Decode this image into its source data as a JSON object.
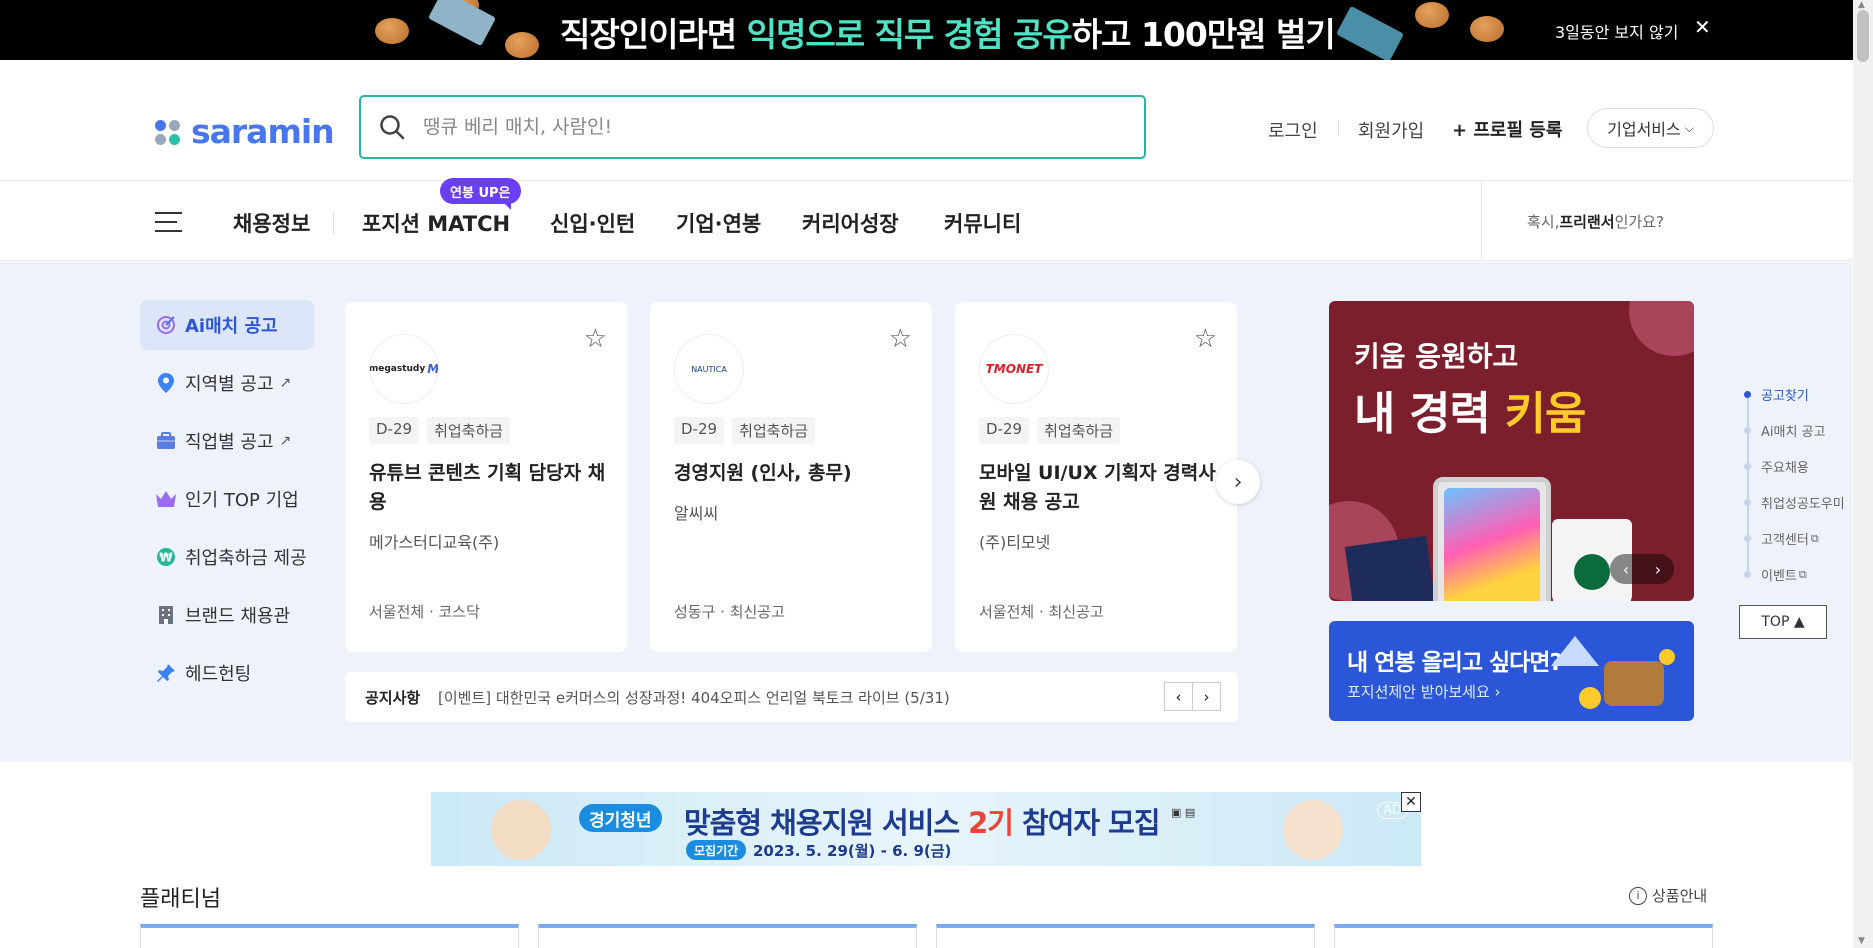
{
  "promo": {
    "title_pre": "직장인이라면 ",
    "title_hl": "익명으로 직무 경험 공유",
    "title_post": "하고 100만원 벌기",
    "dismiss": "3일동안 보지 않기",
    "close": "✕"
  },
  "header": {
    "logo": "saramin",
    "search_placeholder": "땡큐 베리 매치, 사람인!",
    "login": "로그인",
    "signup": "회원가입",
    "profile": "+ 프로필 등록",
    "business": "기업서비스"
  },
  "nav": {
    "items": [
      "채용정보",
      "포지션 MATCH",
      "신입·인턴",
      "기업·연봉",
      "커리어성장",
      "커뮤니티"
    ],
    "badge": "연봉 UP은",
    "freelance_pre": "혹시,",
    "freelance_bold": "프리랜서",
    "freelance_post": "인가요?"
  },
  "sidemenu": [
    {
      "label": "Ai매치 공고",
      "icon": "target-icon"
    },
    {
      "label": "지역별 공고",
      "icon": "location-pin-icon"
    },
    {
      "label": "직업별 공고",
      "icon": "briefcase-icon"
    },
    {
      "label": "인기 TOP 기업",
      "icon": "crown-icon"
    },
    {
      "label": "취업축하금 제공",
      "icon": "won-coin-icon"
    },
    {
      "label": "브랜드 채용관",
      "icon": "building-icon"
    },
    {
      "label": "헤드헌팅",
      "icon": "pin-icon"
    }
  ],
  "jobs": [
    {
      "logo": "megastudy",
      "dday": "D-29",
      "tag": "취업축하금",
      "title": "유튜브 콘텐츠 기획 담당자 채용",
      "company": "메가스터디교육(주)",
      "location": "서울전체 · 코스닥"
    },
    {
      "logo": "NAUTICA",
      "dday": "D-29",
      "tag": "취업축하금",
      "title": "경영지원 (인사, 총무)",
      "company": "알씨씨",
      "location": "성동구 · 최신공고"
    },
    {
      "logo": "TMONET",
      "dday": "D-29",
      "tag": "취업축하금",
      "title": "모바일 UI/UX 기획자 경력사원 채용 공고",
      "company": "(주)티모넷",
      "location": "서울전체 · 최신공고"
    }
  ],
  "notice": {
    "label": "공지사항",
    "text": "[이벤트] 대한민국 e커머스의 성장과정! 404오피스 언리얼 북토크 라이브 (5/31)"
  },
  "ad_kiwoom": {
    "line1": "키움 응원하고",
    "line2_pre": "내 경력 ",
    "line2_hl": "키움"
  },
  "ad_salary": {
    "line1": "내 연봉 올리고 싶다면?",
    "line2": "포지션제안 받아보세요 ›"
  },
  "quicknav": [
    "공고찾기",
    "Ai매치 공고",
    "주요채용",
    "취업성공도우미",
    "고객센터",
    "이벤트"
  ],
  "top_button": "TOP ▲",
  "ad_banner": {
    "badge": "경기청년",
    "title_pre": "맞춤형 채용지원 서비스 ",
    "title_hl": "2기",
    "title_post": " 참여자 모집",
    "period_label": "모집기간",
    "period": "2023. 5. 29(월) - 6. 9(금)",
    "ad_tag": "AD",
    "close": "✕"
  },
  "platinum": {
    "title": "플래티넘",
    "info": "상품안내"
  },
  "colors": {
    "brand_blue": "#4876ef",
    "search_border": "#2bb3a4",
    "badge_purple": "#6a3ff2",
    "section_bg": "#eef3fb"
  }
}
